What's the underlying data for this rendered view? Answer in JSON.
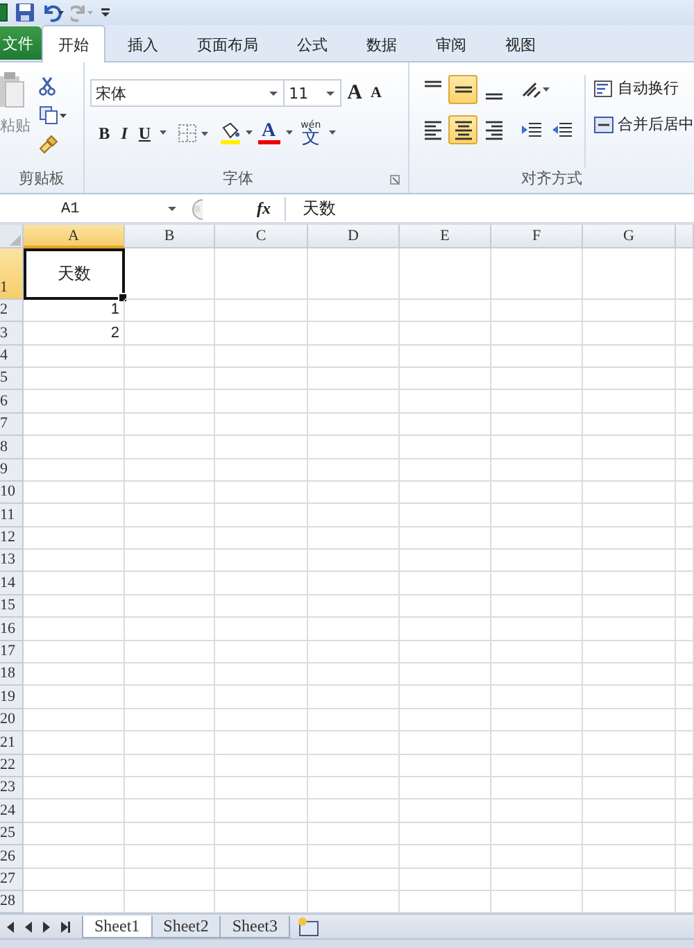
{
  "tabs": [
    {
      "label": "文件",
      "kind": "file",
      "selected": false
    },
    {
      "label": "开始",
      "kind": "tab",
      "selected": true
    },
    {
      "label": "插入",
      "kind": "tab",
      "selected": false
    },
    {
      "label": "页面布局",
      "kind": "tab",
      "selected": false
    },
    {
      "label": "公式",
      "kind": "tab",
      "selected": false
    },
    {
      "label": "数据",
      "kind": "tab",
      "selected": false
    },
    {
      "label": "审阅",
      "kind": "tab",
      "selected": false
    },
    {
      "label": "视图",
      "kind": "tab",
      "selected": false
    }
  ],
  "ribbon": {
    "clipboard": {
      "paste_label": "粘贴",
      "group_label": "剪贴板"
    },
    "font": {
      "font_name": "宋体",
      "font_size": "11",
      "grow_font": "A",
      "shrink_font": "A",
      "bold": "B",
      "italic": "I",
      "underline": "U",
      "font_color": "A",
      "phonetic_top": "wén",
      "phonetic": "文",
      "group_label": "字体"
    },
    "alignment": {
      "vertical": [
        {
          "kind": "top",
          "pressed": false
        },
        {
          "kind": "middle",
          "pressed": true
        },
        {
          "kind": "bottom",
          "pressed": false
        }
      ],
      "horizontal": [
        {
          "kind": "left",
          "pressed": false
        },
        {
          "kind": "center",
          "pressed": true
        },
        {
          "kind": "right",
          "pressed": false
        }
      ],
      "wrap_label": "自动换行",
      "merge_label": "合并后居中",
      "group_label": "对齐方式"
    }
  },
  "formula_bar": {
    "name_box": "A1",
    "function_symbol": "fx",
    "formula": "天数"
  },
  "sheet": {
    "columns": [
      {
        "label": "A",
        "selected": true
      },
      {
        "label": "B",
        "selected": false
      },
      {
        "label": "C",
        "selected": false
      },
      {
        "label": "D",
        "selected": false
      },
      {
        "label": "E",
        "selected": false
      },
      {
        "label": "F",
        "selected": false
      },
      {
        "label": "G",
        "selected": false
      }
    ],
    "rows": [
      {
        "number": "1",
        "selected": true,
        "cells": [
          "天数"
        ]
      },
      {
        "number": "2",
        "selected": false,
        "cells": [
          "1"
        ]
      },
      {
        "number": "3",
        "selected": false,
        "cells": [
          "2"
        ]
      },
      {
        "number": "4",
        "selected": false,
        "cells": []
      },
      {
        "number": "5",
        "selected": false,
        "cells": []
      },
      {
        "number": "6",
        "selected": false,
        "cells": []
      },
      {
        "number": "7",
        "selected": false,
        "cells": []
      },
      {
        "number": "8",
        "selected": false,
        "cells": []
      },
      {
        "number": "9",
        "selected": false,
        "cells": []
      },
      {
        "number": "10",
        "selected": false,
        "cells": []
      },
      {
        "number": "11",
        "selected": false,
        "cells": []
      },
      {
        "number": "12",
        "selected": false,
        "cells": []
      },
      {
        "number": "13",
        "selected": false,
        "cells": []
      },
      {
        "number": "14",
        "selected": false,
        "cells": []
      },
      {
        "number": "15",
        "selected": false,
        "cells": []
      },
      {
        "number": "16",
        "selected": false,
        "cells": []
      },
      {
        "number": "17",
        "selected": false,
        "cells": []
      },
      {
        "number": "18",
        "selected": false,
        "cells": []
      },
      {
        "number": "19",
        "selected": false,
        "cells": []
      },
      {
        "number": "20",
        "selected": false,
        "cells": []
      },
      {
        "number": "21",
        "selected": false,
        "cells": []
      },
      {
        "number": "22",
        "selected": false,
        "cells": []
      },
      {
        "number": "23",
        "selected": false,
        "cells": []
      },
      {
        "number": "24",
        "selected": false,
        "cells": []
      },
      {
        "number": "25",
        "selected": false,
        "cells": []
      },
      {
        "number": "26",
        "selected": false,
        "cells": []
      },
      {
        "number": "27",
        "selected": false,
        "cells": []
      },
      {
        "number": "28",
        "selected": false,
        "cells": []
      }
    ]
  },
  "sheet_tabs": [
    {
      "label": "Sheet1",
      "selected": true
    },
    {
      "label": "Sheet2",
      "selected": false
    },
    {
      "label": "Sheet3",
      "selected": false
    }
  ]
}
